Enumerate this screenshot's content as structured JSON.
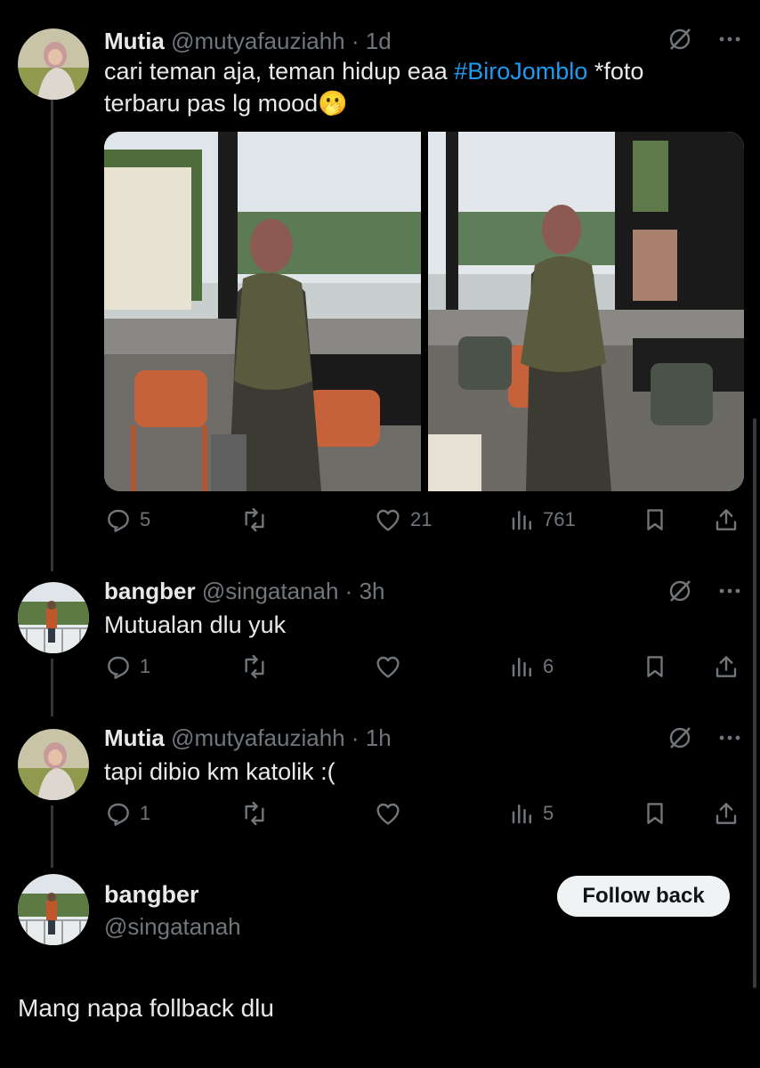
{
  "tweets": [
    {
      "name": "Mutia",
      "handle": "@mutyafauziahh",
      "dot": "·",
      "time": "1d",
      "text_before": "cari teman aja, teman hidup eaa ",
      "hashtag": "#BiroJomblo",
      "text_after": " *foto terbaru pas lg mood",
      "emoji": "🫢",
      "replies": "5",
      "retweets": "",
      "likes": "21",
      "views": "761"
    },
    {
      "name": "bangber",
      "handle": "@singatanah",
      "dot": "·",
      "time": "3h",
      "text": "Mutualan dlu yuk",
      "replies": "1",
      "retweets": "",
      "likes": "",
      "views": "6"
    },
    {
      "name": "Mutia",
      "handle": "@mutyafauziahh",
      "dot": "·",
      "time": "1h",
      "text": "tapi dibio km katolik :(",
      "replies": "1",
      "retweets": "",
      "likes": "",
      "views": "5"
    }
  ],
  "profile": {
    "name": "bangber",
    "handle": "@singatanah",
    "follow_label": "Follow back"
  },
  "composer": {
    "text": "Mang napa follback dlu"
  },
  "colors": {
    "background": "#000000",
    "text": "#e7e9ea",
    "muted": "#71767b",
    "link": "#1d9bf0",
    "button_bg": "#eff3f4"
  },
  "icons": [
    "grok-icon",
    "more-icon",
    "reply-icon",
    "retweet-icon",
    "like-icon",
    "views-icon",
    "bookmark-icon",
    "share-icon"
  ]
}
